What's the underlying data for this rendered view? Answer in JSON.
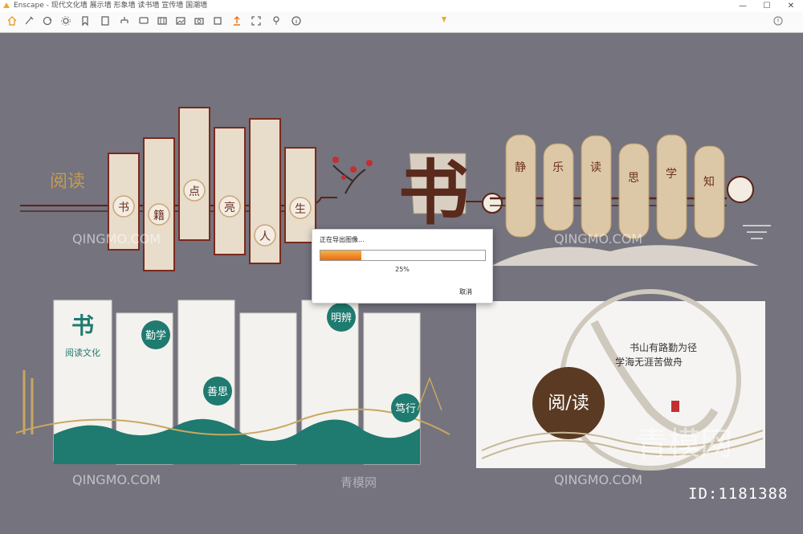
{
  "window": {
    "title": "Enscape - 现代文化墙 展示墙 形象墙 读书墙 宣传墙 国潮墙",
    "accent": "#f0a830",
    "controls": {
      "minimize": "—",
      "maximize": "☐",
      "close": "✕"
    }
  },
  "toolbar": {
    "icons": [
      "home-icon",
      "brush-icon",
      "sync-icon",
      "settings-icon",
      "bookmark-icon",
      "document-icon",
      "hierarchy-icon",
      "chat-icon",
      "film-icon",
      "image-icon",
      "camera-icon",
      "square-icon",
      "export-icon",
      "frame-icon",
      "pin-icon",
      "info-icon",
      "help-icon",
      "menu-icon"
    ]
  },
  "export_dialog": {
    "message": "正在导出图像...",
    "progress_percent": 25,
    "progress_text": "25%",
    "cancel_label": "取消"
  },
  "scene": {
    "top_left_panels": [
      "书",
      "籍",
      "点",
      "亮",
      "人",
      "生"
    ],
    "top_left_title": "阅读",
    "calligraphy_char": "书",
    "top_right_panels": [
      "静",
      "乐",
      "读",
      "思",
      "学",
      "知"
    ],
    "bottom_left_panels": [
      "书",
      "阅读文化",
      "勤学",
      "善思",
      "明辨",
      "笃行"
    ],
    "bottom_right": {
      "badge": "阅/读",
      "line1": "书山有路勤为径",
      "line2": "学海无涯苦做舟"
    }
  },
  "watermarks": {
    "latin": "QINGMO.COM",
    "chinese": "青模网",
    "large": "青模网",
    "id_label": "ID:1181388"
  }
}
